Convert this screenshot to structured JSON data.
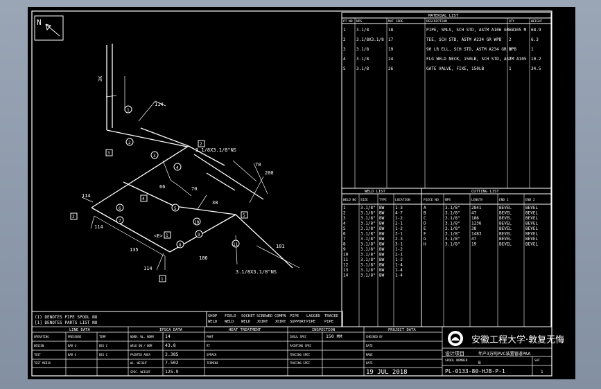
{
  "north_label": "N",
  "iso": {
    "dims": {
      "d114_top": "114",
      "d114_left": "114",
      "d114_side": "114",
      "d114_bottom": "114",
      "d70_a": "70",
      "d70_b": "70",
      "d200": "200",
      "d66": "66",
      "d135": "135",
      "d186": "186",
      "d3k": "3K",
      "d38": "38",
      "d101": "101"
    },
    "reducer_label_1": "3.1/8X3.1/8\"NS",
    "reducer_label_2": "3.1/8X3.1/8\"NS",
    "callouts": [
      "1",
      "2",
      "3",
      "4",
      "5",
      "6",
      "7",
      "8",
      "9",
      "10",
      "11"
    ],
    "tags": [
      "2",
      "3",
      "4",
      "5",
      "1",
      "1"
    ],
    "notes": {
      "ce": "<E>"
    }
  },
  "legend": {
    "line1": "(1) DENOTES PIPE SPOOL NO",
    "line2": "[1] DENOTES PARTS LIST NO"
  },
  "counters": [
    [
      "SHOP",
      "WELD"
    ],
    [
      "FIELD",
      "WELD"
    ],
    [
      "SOCKET",
      "WELD"
    ],
    [
      "SCREWED",
      "JOINT"
    ],
    [
      "COMPN",
      "JOINT"
    ],
    [
      "PIPE",
      "SUPPORT"
    ],
    [
      "LAGGED",
      "PIPE"
    ],
    [
      "TRACED",
      "PIPE"
    ]
  ],
  "material_list": {
    "title": "MATERIAL LIST",
    "headers": [
      "PT NO",
      "NPS",
      "MAT CODE",
      "DESCRIPTION",
      "QTY",
      "WEIGHT"
    ],
    "rows": [
      [
        "1",
        "3.1/8",
        "18",
        "PIPE, SMLS, SCH STD, ASTM A106 GR B",
        "6.105 M",
        "68.9"
      ],
      [
        "2",
        "3.1/8X3.1/8",
        "17",
        "TEE, SCH STD, ASTM A234 GR WPB",
        "2",
        "6.3"
      ],
      [
        "3",
        "3.1/8",
        "19",
        "90 LR ELL, SCH STD, ASTM A234 GR WPB",
        "3",
        "1"
      ],
      [
        "4",
        "3.1/8",
        "24",
        "FLG WELD NECK, 150LB, SCH STD, ASTM A105",
        "2",
        "10.2"
      ],
      [
        "5",
        "3.1/8",
        "26",
        "GATE VALVE, FIXE, 150LB",
        "1",
        "34.5"
      ]
    ]
  },
  "weld_list": {
    "title": "WELD LIST",
    "headers": [
      "WELD NO",
      "SIZE",
      "TYPE",
      "LOCATION"
    ],
    "rows": [
      [
        "1",
        "3.1/8\"",
        "BW",
        "1-3"
      ],
      [
        "2",
        "3.1/8\"",
        "BW",
        "4-7"
      ],
      [
        "3",
        "3.1/8\"",
        "BW",
        "1-2"
      ],
      [
        "4",
        "3.1/8\"",
        "BW",
        "2-1"
      ],
      [
        "5",
        "3.1/8\"",
        "BW",
        "1-2"
      ],
      [
        "6",
        "3.1/8\"",
        "BW",
        "3-1"
      ],
      [
        "7",
        "3.1/8\"",
        "BW",
        "2-3"
      ],
      [
        "8",
        "3.1/8\"",
        "BW",
        "3-1"
      ],
      [
        "9",
        "3.1/8\"",
        "BW",
        "1-2"
      ],
      [
        "10",
        "3.1/8\"",
        "BW",
        "2-1"
      ],
      [
        "11",
        "3.1/8\"",
        "BW",
        "1-2"
      ],
      [
        "12",
        "3.1/8\"",
        "BW",
        "1-4"
      ],
      [
        "13",
        "3.1/8\"",
        "BW",
        "1-4"
      ],
      [
        "14",
        "3.1/8\"",
        "BW",
        "1-4"
      ]
    ]
  },
  "cutting_list": {
    "title": "CUTTING LIST",
    "headers": [
      "PIECE NO",
      "NPS",
      "LENGTH",
      "END 1",
      "END 2"
    ],
    "rows": [
      [
        "A",
        "3.1/8\"",
        "2841",
        "BEVEL",
        "BEVEL"
      ],
      [
        "B",
        "3.1/8\"",
        "47",
        "BEVEL",
        "BEVEL"
      ],
      [
        "C",
        "3.1/8\"",
        "186",
        "BEVEL",
        "BEVEL"
      ],
      [
        "D",
        "3.1/8\"",
        "1236",
        "BEVEL",
        "BEVEL"
      ],
      [
        "E",
        "3.1/8\"",
        "38",
        "BEVEL",
        "BEVEL"
      ],
      [
        "F",
        "3.1/8\"",
        "1483",
        "BEVEL",
        "BEVEL"
      ],
      [
        "G",
        "3.1/8\"",
        "47",
        "BEVEL",
        "BEVEL"
      ],
      [
        "H",
        "3.1/8\"",
        "19",
        "BEVEL",
        "BEVEL"
      ]
    ]
  },
  "bottom": {
    "line_data": "LINE DATA",
    "line_rows": [
      [
        "OPERATING",
        "PRESSURE",
        "TEMP"
      ],
      [
        "DESIGN",
        "BAR G",
        "DEG C"
      ],
      [
        "TEST",
        "BAR G",
        "DEG C"
      ],
      [
        "TEST MEDIA",
        "",
        ""
      ]
    ],
    "line_vals": [
      "DEG C",
      "DEG C"
    ],
    "ipsca_title": "IPSCA DATA",
    "ipsca_rows": [
      [
        "NORM. WL. NORM",
        "14"
      ],
      [
        "WELD DN / NOM",
        "43.8"
      ],
      [
        "PAINTED AREA",
        "2.385"
      ],
      [
        "WL. WEIGHT",
        "7.502"
      ],
      [
        "SPEC. WEIGHT",
        "125.9"
      ]
    ],
    "heat_title": "HEAT TREATMENT",
    "heat_rows": [
      "PWHT",
      "RT",
      "SPRACK",
      "TERMINE"
    ],
    "insp_title": "INSPECTION",
    "insp_rows": [
      [
        "INSUL SPEC",
        "150 MM"
      ],
      [
        "PAINTING SPEC",
        ""
      ],
      [
        "TRACING SPEC",
        ""
      ],
      [
        "TRACING SPEC",
        ""
      ]
    ],
    "project_title": "PROJECT DATA",
    "project_rows": [
      "CHECKED BY",
      "DATE",
      "MADE",
      "DATE"
    ],
    "date": "19 JUL 2018",
    "university": "安徽工程大学·敦复无悔",
    "design_project_label": "设计项目",
    "design_project_value": "年产3万吨PVC装置管道PAA",
    "spool_label": "SPOOL NUMBER",
    "sheet_label": "SHT",
    "spool_number": "PL-0133-80-HJB-P-1",
    "rev": "1",
    "rev_b": "B"
  }
}
